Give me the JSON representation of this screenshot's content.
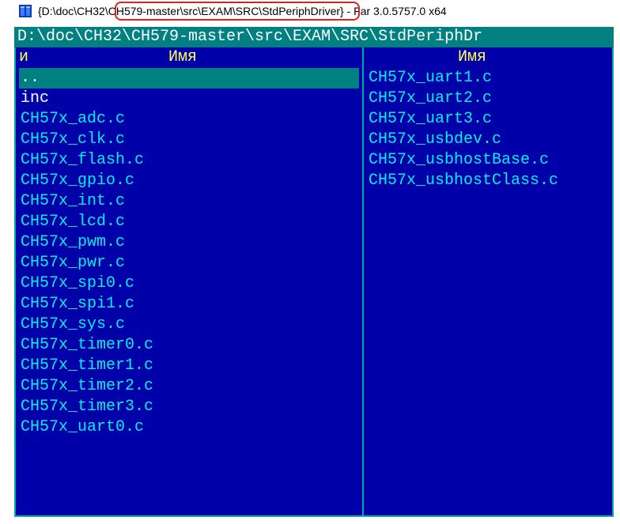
{
  "title": {
    "prefix": "{D:\\doc\\CH32\\",
    "highlight": "CH579-master\\src\\EXAM\\SRC\\StdPeriphDriver}",
    "suffix": " - Far 3.0.5757.0 x64"
  },
  "pathline": " D:\\doc\\CH32\\CH579-master\\src\\EXAM\\SRC\\StdPeriphDr",
  "headers": {
    "left_n": "и",
    "left_name": "Имя",
    "right_name": "Имя"
  },
  "left_panel": [
    {
      "label": "..",
      "type": "dir",
      "selected": true
    },
    {
      "label": "inc",
      "type": "dir",
      "selected": false
    },
    {
      "label": "CH57x_adc.c",
      "type": "file"
    },
    {
      "label": "CH57x_clk.c",
      "type": "file"
    },
    {
      "label": "CH57x_flash.c",
      "type": "file"
    },
    {
      "label": "CH57x_gpio.c",
      "type": "file"
    },
    {
      "label": "CH57x_int.c",
      "type": "file"
    },
    {
      "label": "CH57x_lcd.c",
      "type": "file"
    },
    {
      "label": "CH57x_pwm.c",
      "type": "file"
    },
    {
      "label": "CH57x_pwr.c",
      "type": "file"
    },
    {
      "label": "CH57x_spi0.c",
      "type": "file"
    },
    {
      "label": "CH57x_spi1.c",
      "type": "file"
    },
    {
      "label": "CH57x_sys.c",
      "type": "file"
    },
    {
      "label": "CH57x_timer0.c",
      "type": "file"
    },
    {
      "label": "CH57x_timer1.c",
      "type": "file"
    },
    {
      "label": "CH57x_timer2.c",
      "type": "file"
    },
    {
      "label": "CH57x_timer3.c",
      "type": "file"
    },
    {
      "label": "CH57x_uart0.c",
      "type": "file"
    }
  ],
  "right_panel": [
    {
      "label": "CH57x_uart1.c",
      "type": "file"
    },
    {
      "label": "CH57x_uart2.c",
      "type": "file"
    },
    {
      "label": "CH57x_uart3.c",
      "type": "file"
    },
    {
      "label": "CH57x_usbdev.c",
      "type": "file"
    },
    {
      "label": "CH57x_usbhostBase.c",
      "type": "file"
    },
    {
      "label": "CH57x_usbhostClass.c",
      "type": "file"
    }
  ]
}
